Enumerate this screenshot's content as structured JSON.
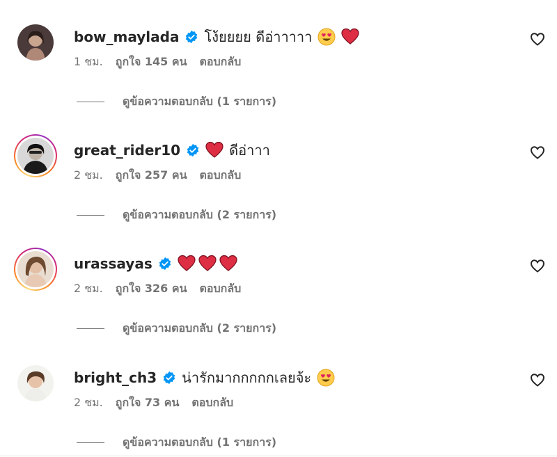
{
  "comments": [
    {
      "username": "bow_maylada",
      "text": "โง้ยยยย ดีอ่าาาาา",
      "emojis": [
        "heart-eyes-emoji",
        "red-heart-emoji"
      ],
      "time": "1 ชม.",
      "likes": "ถูกใจ 145 คน",
      "reply": "ตอบกลับ",
      "view_replies": "ดูข้อความตอบกลับ (1 รายการ)",
      "has_story": false
    },
    {
      "username": "great_rider10",
      "text": "ดีอ่าาา",
      "emojis": [
        "red-heart-emoji"
      ],
      "time": "2 ชม.",
      "likes": "ถูกใจ 257 คน",
      "reply": "ตอบกลับ",
      "view_replies": "ดูข้อความตอบกลับ (2 รายการ)",
      "has_story": true
    },
    {
      "username": "urassayas",
      "text": "",
      "emojis": [
        "red-heart-emoji",
        "red-heart-emoji",
        "red-heart-emoji"
      ],
      "time": "2 ชม.",
      "likes": "ถูกใจ 326 คน",
      "reply": "ตอบกลับ",
      "view_replies": "ดูข้อความตอบกลับ (2 รายการ)",
      "has_story": true
    },
    {
      "username": "bright_ch3",
      "text": "น่ารักมากกกกกเลยจ้ะ",
      "emojis": [
        "heart-eyes-emoji"
      ],
      "time": "2 ชม.",
      "likes": "ถูกใจ 73 คน",
      "reply": "ตอบกลับ",
      "view_replies": "ดูข้อความตอบกลับ (1 รายการ)",
      "has_story": false
    }
  ],
  "icons": {
    "verified": "verified-badge-icon",
    "like": "heart-outline-icon"
  },
  "colors": {
    "verified_blue": "#0095f6",
    "meta_gray": "#737373",
    "heart_red": "#e0245e"
  }
}
